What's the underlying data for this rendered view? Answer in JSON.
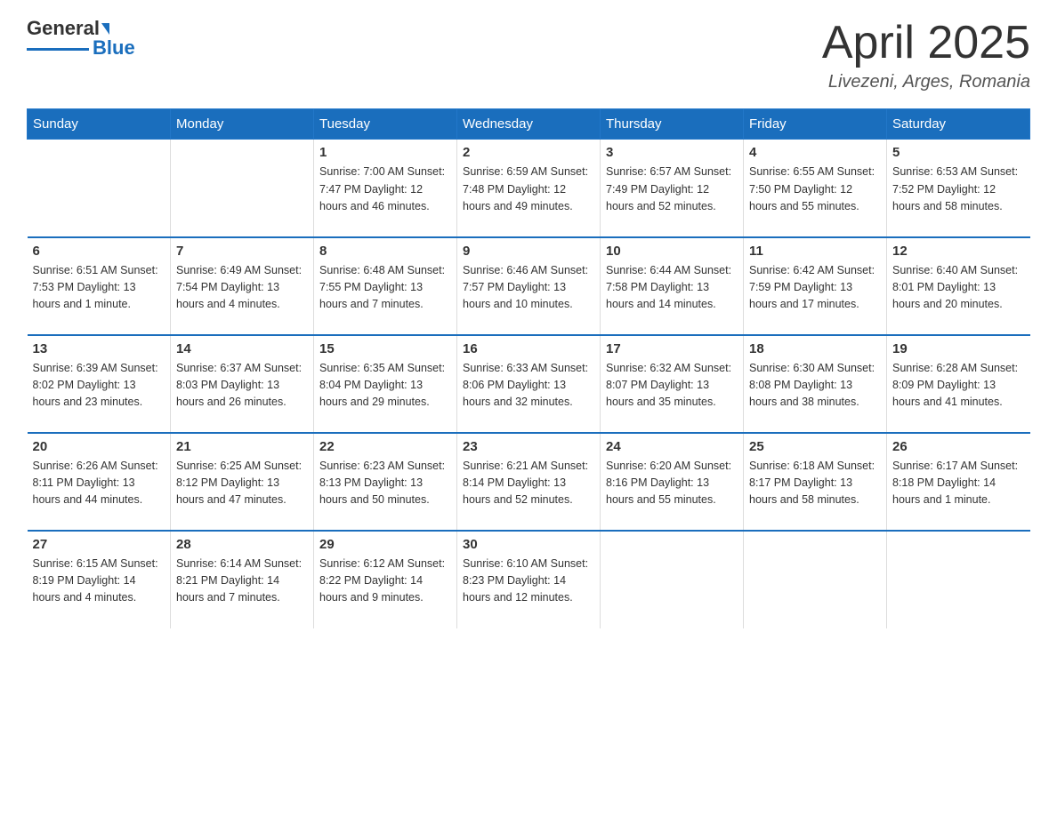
{
  "header": {
    "logo_line1": "General",
    "logo_line2": "Blue",
    "title": "April 2025",
    "subtitle": "Livezeni, Arges, Romania"
  },
  "days_of_week": [
    "Sunday",
    "Monday",
    "Tuesday",
    "Wednesday",
    "Thursday",
    "Friday",
    "Saturday"
  ],
  "weeks": [
    [
      {
        "day": "",
        "info": ""
      },
      {
        "day": "",
        "info": ""
      },
      {
        "day": "1",
        "info": "Sunrise: 7:00 AM\nSunset: 7:47 PM\nDaylight: 12 hours\nand 46 minutes."
      },
      {
        "day": "2",
        "info": "Sunrise: 6:59 AM\nSunset: 7:48 PM\nDaylight: 12 hours\nand 49 minutes."
      },
      {
        "day": "3",
        "info": "Sunrise: 6:57 AM\nSunset: 7:49 PM\nDaylight: 12 hours\nand 52 minutes."
      },
      {
        "day": "4",
        "info": "Sunrise: 6:55 AM\nSunset: 7:50 PM\nDaylight: 12 hours\nand 55 minutes."
      },
      {
        "day": "5",
        "info": "Sunrise: 6:53 AM\nSunset: 7:52 PM\nDaylight: 12 hours\nand 58 minutes."
      }
    ],
    [
      {
        "day": "6",
        "info": "Sunrise: 6:51 AM\nSunset: 7:53 PM\nDaylight: 13 hours\nand 1 minute."
      },
      {
        "day": "7",
        "info": "Sunrise: 6:49 AM\nSunset: 7:54 PM\nDaylight: 13 hours\nand 4 minutes."
      },
      {
        "day": "8",
        "info": "Sunrise: 6:48 AM\nSunset: 7:55 PM\nDaylight: 13 hours\nand 7 minutes."
      },
      {
        "day": "9",
        "info": "Sunrise: 6:46 AM\nSunset: 7:57 PM\nDaylight: 13 hours\nand 10 minutes."
      },
      {
        "day": "10",
        "info": "Sunrise: 6:44 AM\nSunset: 7:58 PM\nDaylight: 13 hours\nand 14 minutes."
      },
      {
        "day": "11",
        "info": "Sunrise: 6:42 AM\nSunset: 7:59 PM\nDaylight: 13 hours\nand 17 minutes."
      },
      {
        "day": "12",
        "info": "Sunrise: 6:40 AM\nSunset: 8:01 PM\nDaylight: 13 hours\nand 20 minutes."
      }
    ],
    [
      {
        "day": "13",
        "info": "Sunrise: 6:39 AM\nSunset: 8:02 PM\nDaylight: 13 hours\nand 23 minutes."
      },
      {
        "day": "14",
        "info": "Sunrise: 6:37 AM\nSunset: 8:03 PM\nDaylight: 13 hours\nand 26 minutes."
      },
      {
        "day": "15",
        "info": "Sunrise: 6:35 AM\nSunset: 8:04 PM\nDaylight: 13 hours\nand 29 minutes."
      },
      {
        "day": "16",
        "info": "Sunrise: 6:33 AM\nSunset: 8:06 PM\nDaylight: 13 hours\nand 32 minutes."
      },
      {
        "day": "17",
        "info": "Sunrise: 6:32 AM\nSunset: 8:07 PM\nDaylight: 13 hours\nand 35 minutes."
      },
      {
        "day": "18",
        "info": "Sunrise: 6:30 AM\nSunset: 8:08 PM\nDaylight: 13 hours\nand 38 minutes."
      },
      {
        "day": "19",
        "info": "Sunrise: 6:28 AM\nSunset: 8:09 PM\nDaylight: 13 hours\nand 41 minutes."
      }
    ],
    [
      {
        "day": "20",
        "info": "Sunrise: 6:26 AM\nSunset: 8:11 PM\nDaylight: 13 hours\nand 44 minutes."
      },
      {
        "day": "21",
        "info": "Sunrise: 6:25 AM\nSunset: 8:12 PM\nDaylight: 13 hours\nand 47 minutes."
      },
      {
        "day": "22",
        "info": "Sunrise: 6:23 AM\nSunset: 8:13 PM\nDaylight: 13 hours\nand 50 minutes."
      },
      {
        "day": "23",
        "info": "Sunrise: 6:21 AM\nSunset: 8:14 PM\nDaylight: 13 hours\nand 52 minutes."
      },
      {
        "day": "24",
        "info": "Sunrise: 6:20 AM\nSunset: 8:16 PM\nDaylight: 13 hours\nand 55 minutes."
      },
      {
        "day": "25",
        "info": "Sunrise: 6:18 AM\nSunset: 8:17 PM\nDaylight: 13 hours\nand 58 minutes."
      },
      {
        "day": "26",
        "info": "Sunrise: 6:17 AM\nSunset: 8:18 PM\nDaylight: 14 hours\nand 1 minute."
      }
    ],
    [
      {
        "day": "27",
        "info": "Sunrise: 6:15 AM\nSunset: 8:19 PM\nDaylight: 14 hours\nand 4 minutes."
      },
      {
        "day": "28",
        "info": "Sunrise: 6:14 AM\nSunset: 8:21 PM\nDaylight: 14 hours\nand 7 minutes."
      },
      {
        "day": "29",
        "info": "Sunrise: 6:12 AM\nSunset: 8:22 PM\nDaylight: 14 hours\nand 9 minutes."
      },
      {
        "day": "30",
        "info": "Sunrise: 6:10 AM\nSunset: 8:23 PM\nDaylight: 14 hours\nand 12 minutes."
      },
      {
        "day": "",
        "info": ""
      },
      {
        "day": "",
        "info": ""
      },
      {
        "day": "",
        "info": ""
      }
    ]
  ]
}
